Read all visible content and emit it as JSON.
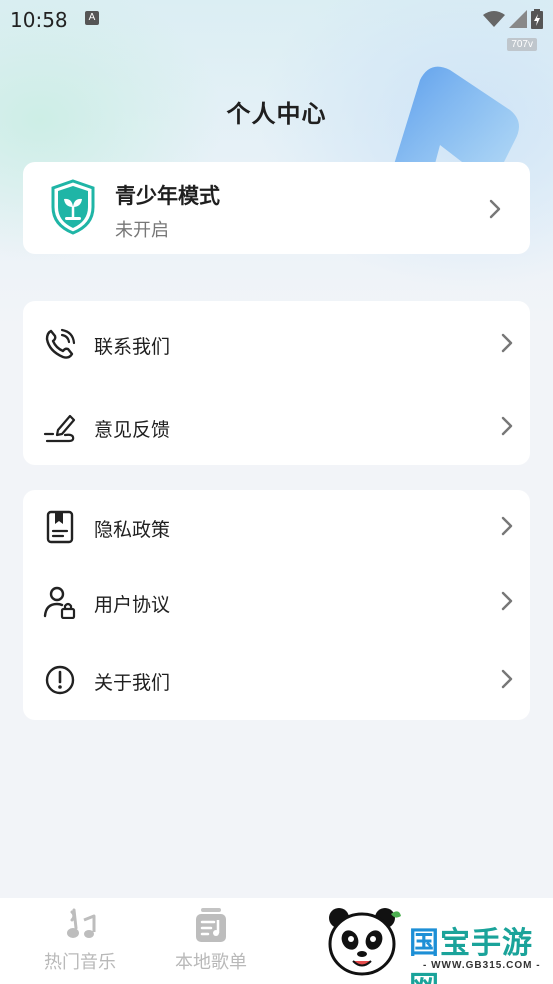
{
  "status_bar": {
    "time": "10:58",
    "notification_icon": "a-icon",
    "badge": "707v",
    "icons": [
      "wifi-icon",
      "signal-icon",
      "battery-icon"
    ]
  },
  "header": {
    "title": "个人中心"
  },
  "youth_mode": {
    "title": "青少年模式",
    "status": "未开启",
    "icon": "shield-sprout-icon"
  },
  "menu_group_1": [
    {
      "label": "联系我们",
      "icon": "phone-icon"
    },
    {
      "label": "意见反馈",
      "icon": "pen-feedback-icon"
    }
  ],
  "menu_group_2": [
    {
      "label": "隐私政策",
      "icon": "document-icon"
    },
    {
      "label": "用户协议",
      "icon": "user-lock-icon"
    },
    {
      "label": "关于我们",
      "icon": "info-alert-icon"
    }
  ],
  "bottom_nav": [
    {
      "label": "热门音乐",
      "icon": "music-note-icon"
    },
    {
      "label": "本地歌单",
      "icon": "playlist-icon"
    }
  ],
  "watermark": {
    "text_1": "国",
    "text_2": "宝手游网",
    "url": "- WWW.GB315.COM -"
  },
  "colors": {
    "accent_teal": "#1fb5a6",
    "text_primary": "#1f1f1f",
    "text_secondary": "#777777",
    "nav_inactive": "#b9b9b9",
    "background": "#f2f4f8"
  }
}
